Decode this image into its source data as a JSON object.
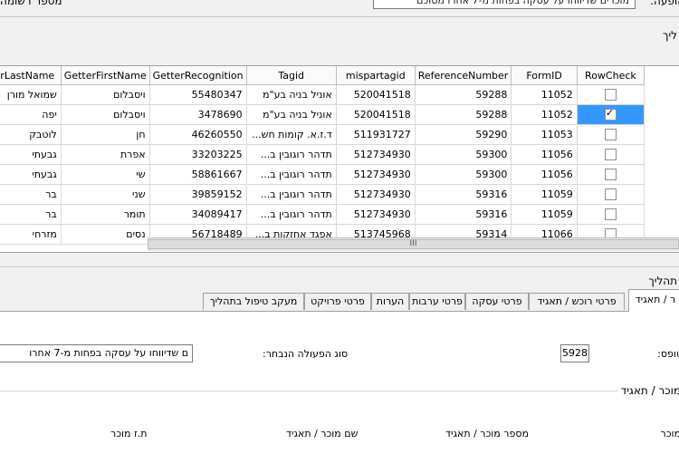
{
  "top": {
    "label_right": "הופעה:",
    "input_value": "מוכרים שדיווחו על עסקה בפחות מ-7 אחרו מסוכם",
    "label_left": "מספר רשומה"
  },
  "section_label_top": "ליך",
  "grid": {
    "columns": [
      "GetterLastName",
      "GetterFirstName",
      "GetterRecognition",
      "Tagid",
      "mispartagid",
      "ReferenceNumber",
      "FormID",
      "RowCheck"
    ],
    "rows": [
      {
        "last": "שמואל מורן",
        "first": "ויסבלום",
        "recog": "55480347",
        "tagid": "אוניל בניה בע\"מ",
        "mispar": "520041518",
        "ref": "59288",
        "form": "11052",
        "checked": false,
        "selected": false
      },
      {
        "last": "יפה",
        "first": "ויסבלום",
        "recog": "3478690",
        "tagid": "אוניל בניה בע\"מ",
        "mispar": "520041518",
        "ref": "59288",
        "form": "11052",
        "checked": true,
        "selected": true
      },
      {
        "last": "לוטבק",
        "first": "חן",
        "recog": "46260550",
        "tagid": "ד.ז.א. קומות חש...",
        "mispar": "511931727",
        "ref": "59290",
        "form": "11053",
        "checked": false,
        "selected": false
      },
      {
        "last": "גבעתי",
        "first": "אפרת",
        "recog": "33203225",
        "tagid": "תדהר רוגובין ב...",
        "mispar": "512734930",
        "ref": "59300",
        "form": "11056",
        "checked": false,
        "selected": false
      },
      {
        "last": "גבעתי",
        "first": "שי",
        "recog": "58861667",
        "tagid": "תדהר רוגובין ב...",
        "mispar": "512734930",
        "ref": "59300",
        "form": "11056",
        "checked": false,
        "selected": false
      },
      {
        "last": "בר",
        "first": "שני",
        "recog": "39859152",
        "tagid": "תדהר רוגובין ב...",
        "mispar": "512734930",
        "ref": "59316",
        "form": "11059",
        "checked": false,
        "selected": false
      },
      {
        "last": "בר",
        "first": "תומר",
        "recog": "34089417",
        "tagid": "תדהר רוגובין ב...",
        "mispar": "512734930",
        "ref": "59316",
        "form": "11059",
        "checked": false,
        "selected": false
      },
      {
        "last": "מזרחי",
        "first": "נסים",
        "recog": "56718489",
        "tagid": "אפגד אחזקות ב...",
        "mispar": "513745968",
        "ref": "59314",
        "form": "11066",
        "checked": false,
        "selected": false
      }
    ],
    "scroll_grip": "III"
  },
  "section_label_mid": "תהליך",
  "tabs": [
    {
      "label": "ר / תאגיד",
      "active": true
    },
    {
      "label": "פרטי רוכש / תאגיד",
      "active": false
    },
    {
      "label": "פרטי עסקה",
      "active": false
    },
    {
      "label": "פרטי ערבות",
      "active": false
    },
    {
      "label": "הערות",
      "active": false
    },
    {
      "label": "פרטי פרויקט",
      "active": false
    },
    {
      "label": "מעקב טיפול בתהליך",
      "active": false
    }
  ],
  "panel": {
    "label_topes": "טופס:",
    "topes_value": "5928",
    "label_action": "סוג הפעולה הנבחר:",
    "action_value": "ם שדיווחו על עסקה בפחות מ-7 אחרו",
    "group_label": "מוכר / תאגיד",
    "col_labels": [
      "מוכר",
      "מספר מוכר / תאגיד",
      "שם מוכר / תאגיד",
      "ת.ז מוכר"
    ]
  }
}
